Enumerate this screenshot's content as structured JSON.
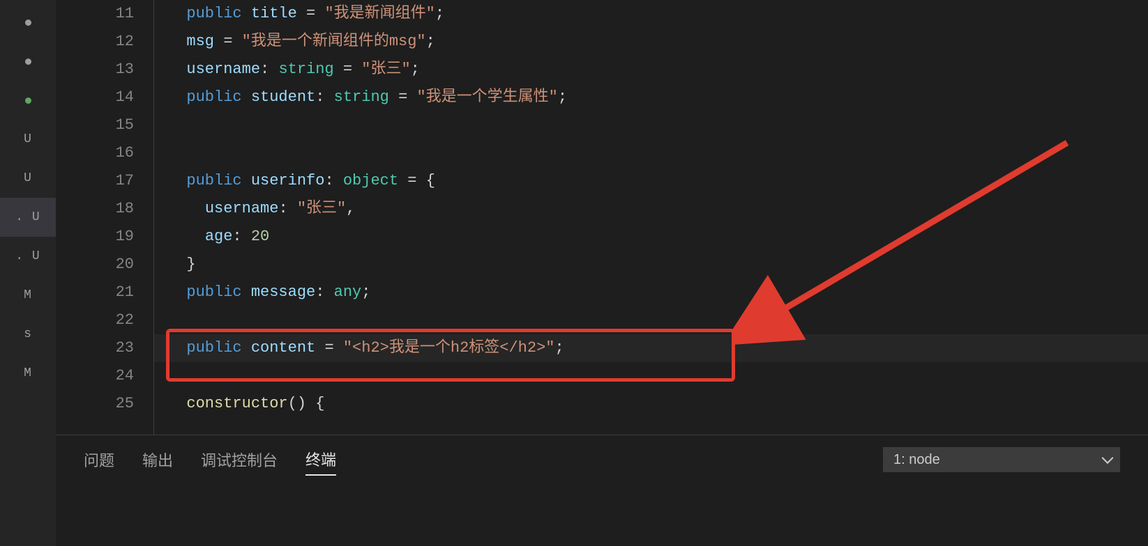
{
  "sidebar": {
    "items": [
      {
        "type": "dot",
        "color": "gray"
      },
      {
        "type": "dot",
        "color": "gray"
      },
      {
        "type": "dot",
        "color": "green"
      },
      {
        "label": "U"
      },
      {
        "label": "U"
      },
      {
        "label": ". U",
        "active": true
      },
      {
        "label": ". U"
      },
      {
        "label": "M"
      },
      {
        "label": "s"
      },
      {
        "label": "M"
      }
    ]
  },
  "editor": {
    "line_start": 11,
    "line_end": 25,
    "current_line": 23,
    "lines": {
      "11": {
        "indent": 1,
        "kw1": "public",
        "id": "title",
        "eq": " = ",
        "str": "\"我是新闻组件\"",
        "end": ";"
      },
      "12": {
        "indent": 1,
        "id": "msg",
        "eq": " = ",
        "str": "\"我是一个新闻组件的msg\"",
        "end": ";"
      },
      "13": {
        "indent": 1,
        "id": "username",
        "colon": ": ",
        "type": "string",
        "eq": " = ",
        "str": "\"张三\"",
        "end": ";"
      },
      "14": {
        "indent": 1,
        "kw1": "public",
        "id": "student",
        "colon": ": ",
        "type": "string",
        "eq": " = ",
        "str": "\"我是一个学生属性\"",
        "end": ";"
      },
      "15": {
        "text": ""
      },
      "16": {
        "text": ""
      },
      "17": {
        "indent": 1,
        "kw1": "public",
        "id": "userinfo",
        "colon": ": ",
        "type": "object",
        "eq": " = ",
        "brace": "{"
      },
      "18": {
        "indent": 2,
        "id": "username",
        "colon": ": ",
        "str": "\"张三\"",
        "end": ","
      },
      "19": {
        "indent": 2,
        "id": "age",
        "colon": ": ",
        "num": "20"
      },
      "20": {
        "indent": 1,
        "brace": "}"
      },
      "21": {
        "indent": 1,
        "kw1": "public",
        "id": "message",
        "colon": ": ",
        "type": "any",
        "end": ";"
      },
      "22": {
        "text": ""
      },
      "23": {
        "indent": 1,
        "kw1": "public",
        "id": "content",
        "eq": " = ",
        "str": "\"<h2>我是一个h2标签</h2>\"",
        "end": ";"
      },
      "24": {
        "text": ""
      },
      "25": {
        "indent": 1,
        "fn": "constructor",
        "paren": "()",
        "sp": " ",
        "brace": "{"
      }
    }
  },
  "panel": {
    "tabs": {
      "problems": "问题",
      "output": "输出",
      "debug": "调试控制台",
      "terminal": "终端"
    },
    "active_tab": "terminal",
    "terminal_select": "1: node"
  }
}
